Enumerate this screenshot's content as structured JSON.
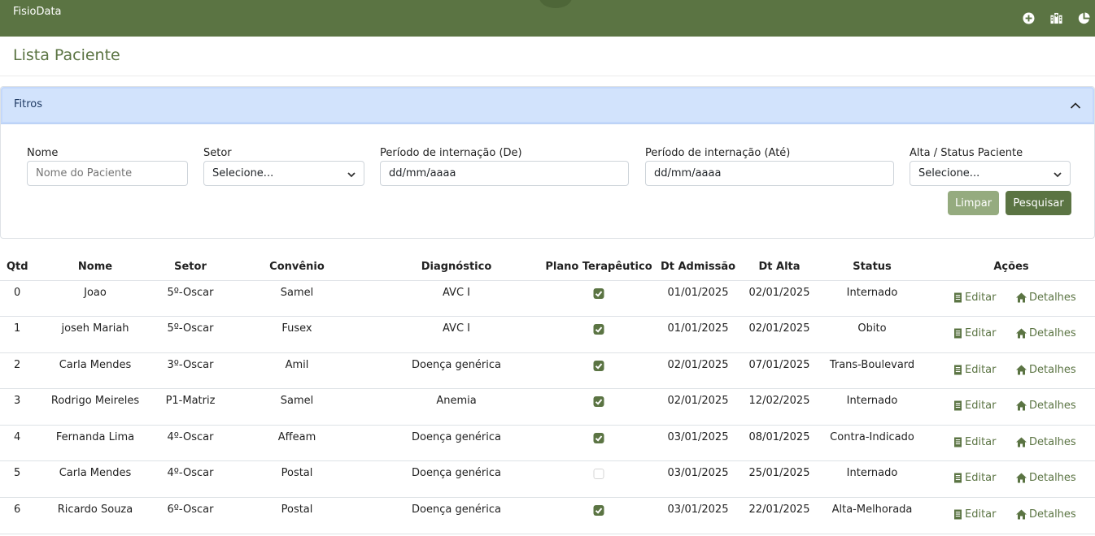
{
  "app": {
    "brand": "FisioData",
    "page_title": "Lista Paciente",
    "top_icons": [
      "plus-circle-icon",
      "hospital-icon",
      "pie-chart-icon"
    ]
  },
  "filters": {
    "header": "Fitros",
    "nome": {
      "label": "Nome",
      "placeholder": "Nome do Paciente"
    },
    "setor": {
      "label": "Setor",
      "value": "Selecione..."
    },
    "periodo_de": {
      "label": "Período de internação (De)",
      "value": "dd/mm/aaaa"
    },
    "periodo_ate": {
      "label": "Período de internação (Até)",
      "value": "dd/mm/aaaa"
    },
    "status": {
      "label": "Alta / Status Paciente",
      "value": "Selecione..."
    },
    "clear_label": "Limpar",
    "search_label": "Pesquisar"
  },
  "table": {
    "headers": [
      "Qtd",
      "Nome",
      "Setor",
      "Convênio",
      "Diagnóstico",
      "Plano Terapêutico",
      "Dt Admissão",
      "Dt Alta",
      "Status",
      "Ações"
    ],
    "edit_label": "Editar",
    "details_label": "Detalhes",
    "rows": [
      {
        "qtd": "0",
        "nome": "Joao",
        "setor": "5º-Oscar",
        "convenio": "Samel",
        "diagnostico": "AVC I",
        "plano": true,
        "admissao": "01/01/2025",
        "alta": "02/01/2025",
        "status": "Internado"
      },
      {
        "qtd": "1",
        "nome": "joseh Mariah",
        "setor": "5º-Oscar",
        "convenio": "Fusex",
        "diagnostico": "AVC I",
        "plano": true,
        "admissao": "01/01/2025",
        "alta": "02/01/2025",
        "status": "Obito"
      },
      {
        "qtd": "2",
        "nome": "Carla Mendes",
        "setor": "3º-Oscar",
        "convenio": "Amil",
        "diagnostico": "Doença genérica",
        "plano": true,
        "admissao": "02/01/2025",
        "alta": "07/01/2025",
        "status": "Trans-Boulevard"
      },
      {
        "qtd": "3",
        "nome": "Rodrigo Meireles",
        "setor": "P1-Matriz",
        "convenio": "Samel",
        "diagnostico": "Anemia",
        "plano": true,
        "admissao": "02/01/2025",
        "alta": "12/02/2025",
        "status": "Internado"
      },
      {
        "qtd": "4",
        "nome": "Fernanda Lima",
        "setor": "4º-Oscar",
        "convenio": "Affeam",
        "diagnostico": "Doença genérica",
        "plano": true,
        "admissao": "03/01/2025",
        "alta": "08/01/2025",
        "status": "Contra-Indicado"
      },
      {
        "qtd": "5",
        "nome": "Carla Mendes",
        "setor": "4º-Oscar",
        "convenio": "Postal",
        "diagnostico": "Doença genérica",
        "plano": false,
        "admissao": "03/01/2025",
        "alta": "25/01/2025",
        "status": "Internado"
      },
      {
        "qtd": "6",
        "nome": "Ricardo Souza",
        "setor": "6º-Oscar",
        "convenio": "Postal",
        "diagnostico": "Doença genérica",
        "plano": true,
        "admissao": "03/01/2025",
        "alta": "22/01/2025",
        "status": "Alta-Melhorada"
      }
    ]
  }
}
